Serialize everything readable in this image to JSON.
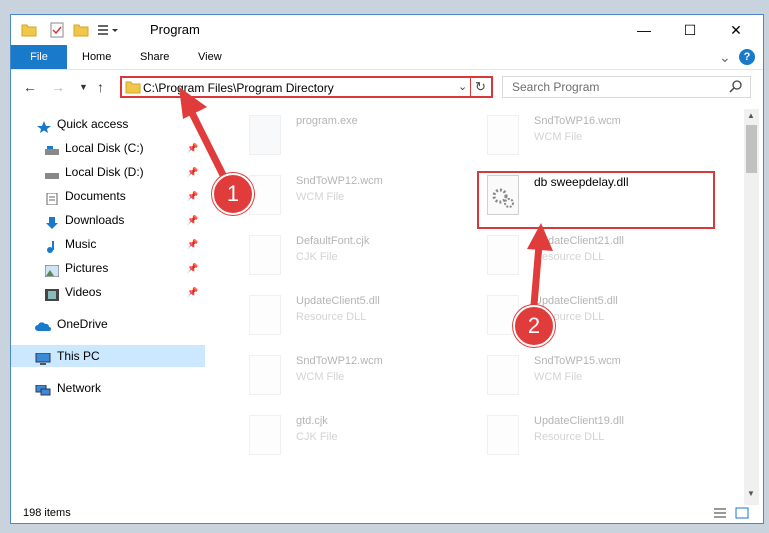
{
  "window": {
    "title": "Program",
    "minimize": "—",
    "maximize": "☐",
    "close": "✕"
  },
  "ribbon": {
    "tabs": [
      "File",
      "Home",
      "Share",
      "View"
    ],
    "expand": "⌄",
    "help": "?"
  },
  "address": {
    "path": "C:\\Program Files\\Program Directory",
    "search_placeholder": "Search Program"
  },
  "nav": {
    "items": [
      {
        "label": "Quick access",
        "icon": "star-icon"
      },
      {
        "label": "Local Disk (C:)",
        "icon": "drive-icon",
        "pinned": true
      },
      {
        "label": "Local Disk (D:)",
        "icon": "drive-icon",
        "pinned": true
      },
      {
        "label": "Documents",
        "icon": "documents-icon",
        "pinned": true
      },
      {
        "label": "Downloads",
        "icon": "downloads-icon",
        "pinned": true
      },
      {
        "label": "Music",
        "icon": "music-icon",
        "pinned": true
      },
      {
        "label": "Pictures",
        "icon": "pictures-icon",
        "pinned": true
      },
      {
        "label": "Videos",
        "icon": "videos-icon",
        "pinned": true
      },
      {
        "label": "OneDrive",
        "icon": "cloud-icon"
      },
      {
        "label": "This PC",
        "icon": "computer-icon",
        "selected": true
      },
      {
        "label": "Network",
        "icon": "network-icon"
      }
    ]
  },
  "files": [
    {
      "name": "program.exe",
      "type": "",
      "faded": true
    },
    {
      "name": "SndToWP16.wcm",
      "type": "WCM File",
      "faded": true
    },
    {
      "name": "SndToWP12.wcm",
      "type": "WCM File",
      "faded": true
    },
    {
      "name": "db sweepdelay.dll",
      "type": "",
      "faded": false
    },
    {
      "name": "DefaultFont.cjk",
      "type": "CJK File",
      "faded": true
    },
    {
      "name": "UpdateClient21.dll",
      "type": "Resource DLL",
      "faded": true
    },
    {
      "name": "UpdateClient5.dll",
      "type": "Resource DLL",
      "faded": true
    },
    {
      "name": "UpdateClient5.dll",
      "type": "Resource DLL",
      "faded": true
    },
    {
      "name": "SndToWP12.wcm",
      "type": "WCM File",
      "faded": true
    },
    {
      "name": "SndToWP15.wcm",
      "type": "WCM File",
      "faded": true
    },
    {
      "name": "gtd.cjk",
      "type": "CJK File",
      "faded": true
    },
    {
      "name": "UpdateClient19.dll",
      "type": "Resource DLL",
      "faded": true
    }
  ],
  "status": {
    "items_count": "198 items"
  },
  "callouts": [
    "1",
    "2"
  ],
  "colors": {
    "accent": "#1979ca",
    "highlight": "#d8383a",
    "selected_nav": "#cce8ff"
  }
}
